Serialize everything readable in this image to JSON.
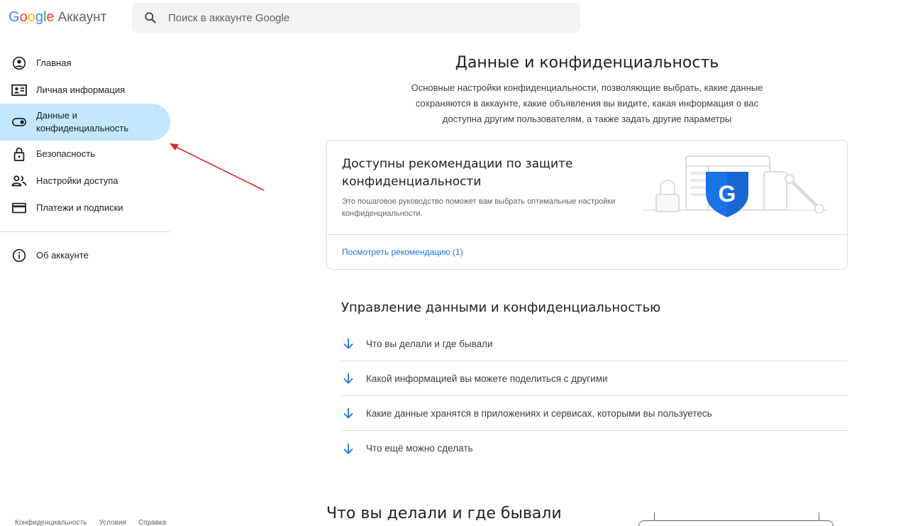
{
  "header": {
    "logo": {
      "G": "G",
      "o1": "o",
      "o2": "o",
      "g": "g",
      "l": "l",
      "e": "e",
      "product": "Аккаунт"
    },
    "search": {
      "placeholder": "Поиск в аккаунте Google",
      "icon": "search-icon"
    }
  },
  "sidebar": {
    "items": [
      {
        "label": "Главная",
        "icon": "account-circle-icon"
      },
      {
        "label": "Личная информация",
        "icon": "id-card-icon"
      },
      {
        "label": "Данные и конфиденциальность",
        "icon": "toggle-icon",
        "active": true
      },
      {
        "label": "Безопасность",
        "icon": "lock-icon"
      },
      {
        "label": "Настройки доступа",
        "icon": "people-icon"
      },
      {
        "label": "Платежи и подписки",
        "icon": "credit-card-icon"
      }
    ],
    "secondary": [
      {
        "label": "Об аккаунте",
        "icon": "info-icon"
      }
    ],
    "active_color": "#c2e7ff"
  },
  "footer": {
    "links": [
      "Конфиденциальность",
      "Условия",
      "Справка"
    ]
  },
  "main": {
    "title": "Данные и конфиденциальность",
    "description": "Основные настройки конфиденциальности, позволяющие выбрать, какие данные сохраняются в аккаунте, какие объявления вы видите, какая информация о вас доступна другим пользователям, а также задать другие параметры",
    "card": {
      "title": "Доступны рекомендации по защите конфиденциальности",
      "description": "Это пошаговое руководство поможет вам выбрать оптимальные настройки конфиденциальности.",
      "link": "Посмотреть рекомендацию (1)",
      "badge_letter": "G"
    },
    "manage_section": {
      "title": "Управление данными и конфиденциальностью",
      "items": [
        "Что вы делали и где бывали",
        "Какой информацией вы можете поделиться с другими",
        "Какие данные хранятся в приложениях и сервисах, которыми вы пользуетесь",
        "Что ещё можно сделать"
      ]
    },
    "bottom_section": {
      "title": "Что вы делали и где бывали"
    }
  },
  "colors": {
    "accent": "#1a73e8",
    "annotation_arrow": "#d32f2f",
    "shield": "#1a73e8"
  }
}
